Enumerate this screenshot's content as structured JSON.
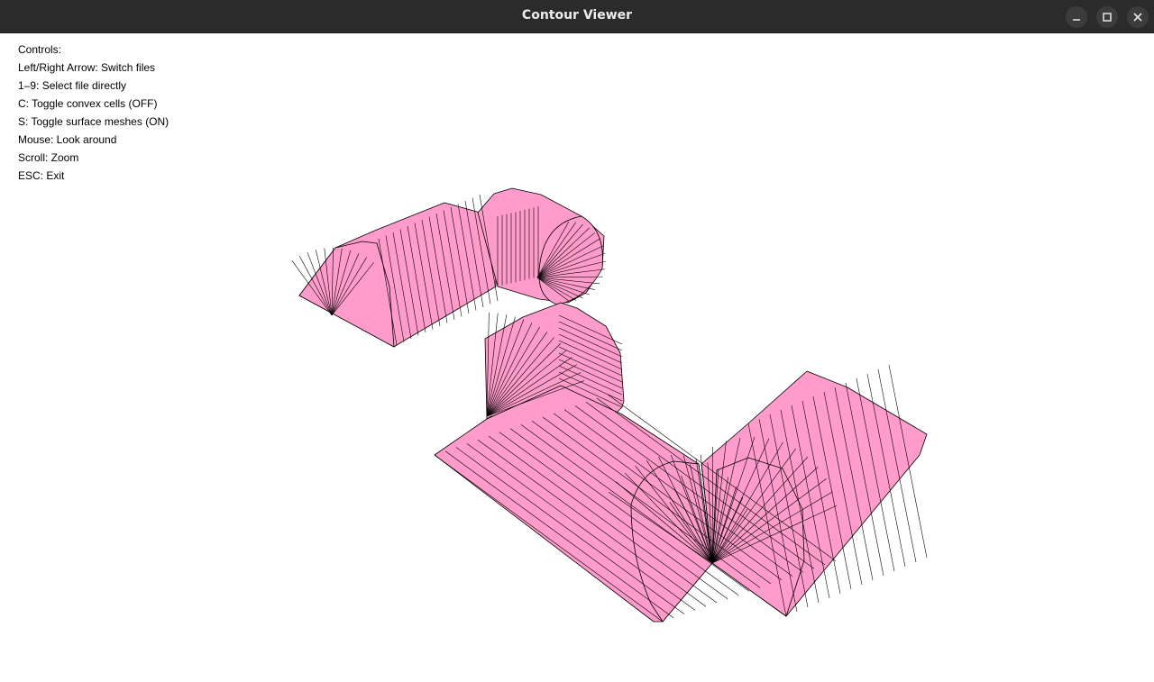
{
  "window": {
    "title": "Contour Viewer",
    "buttons": {
      "minimize": "minimize-icon",
      "maximize": "maximize-icon",
      "close": "close-icon"
    }
  },
  "controls": {
    "heading": "Controls:",
    "lines": [
      "Left/Right Arrow: Switch files",
      "1–9: Select file directly",
      "C: Toggle convex cells (OFF)",
      "S: Toggle surface meshes (ON)",
      "Mouse: Look around",
      "Scroll: Zoom",
      "ESC: Exit"
    ]
  },
  "colors": {
    "mesh_fill": "#ff9ccb",
    "mesh_edge": "#000000",
    "titlebar": "#2b2b2b",
    "background": "#ffffff"
  }
}
